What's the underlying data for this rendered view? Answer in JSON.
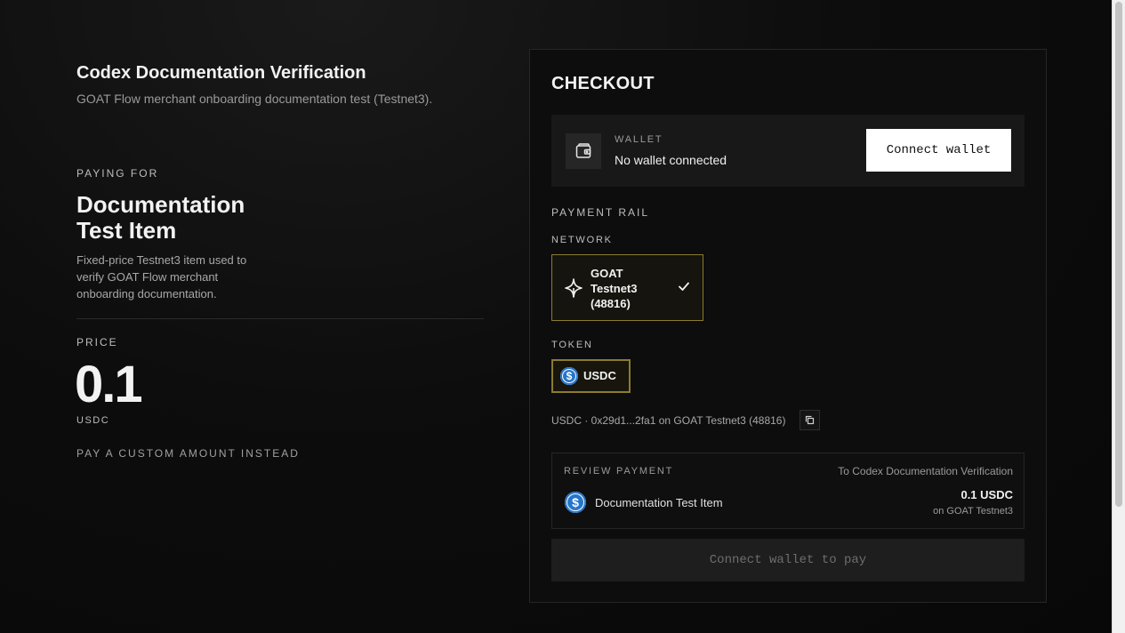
{
  "merchant": {
    "name": "Codex Documentation Verification",
    "description": "GOAT Flow merchant onboarding documentation test (Testnet3)."
  },
  "item": {
    "paying_for_label": "PAYING FOR",
    "name": "Documentation Test Item",
    "description": "Fixed-price Testnet3 item used to verify GOAT Flow merchant onboarding documentation.",
    "price_label": "PRICE",
    "price": "0.1",
    "currency": "USDC",
    "custom_amount_link": "PAY A CUSTOM AMOUNT INSTEAD"
  },
  "checkout": {
    "title": "CHECKOUT",
    "wallet": {
      "label": "WALLET",
      "status": "No wallet connected",
      "connect_label": "Connect wallet",
      "icon": "wallet-icon"
    },
    "payment_rail_label": "PAYMENT RAIL",
    "network_label": "NETWORK",
    "network": {
      "name": "GOAT Testnet3 (48816)",
      "selected": true,
      "icon": "goat-logo-icon"
    },
    "token_label": "TOKEN",
    "token": {
      "symbol": "USDC",
      "icon": "usdc-icon",
      "selected": true
    },
    "contract_line": "USDC · 0x29d1...2fa1 on GOAT Testnet3 (48816)",
    "review": {
      "label": "REVIEW PAYMENT",
      "to": "To Codex Documentation Verification",
      "item": "Documentation Test Item",
      "amount": "0.1 USDC",
      "network": "on GOAT Testnet3"
    },
    "pay_button_label": "Connect wallet to pay"
  },
  "colors": {
    "background": "#0b0b0b",
    "selected_border": "#8c7b30",
    "usdc_blue": "#2775ca"
  }
}
